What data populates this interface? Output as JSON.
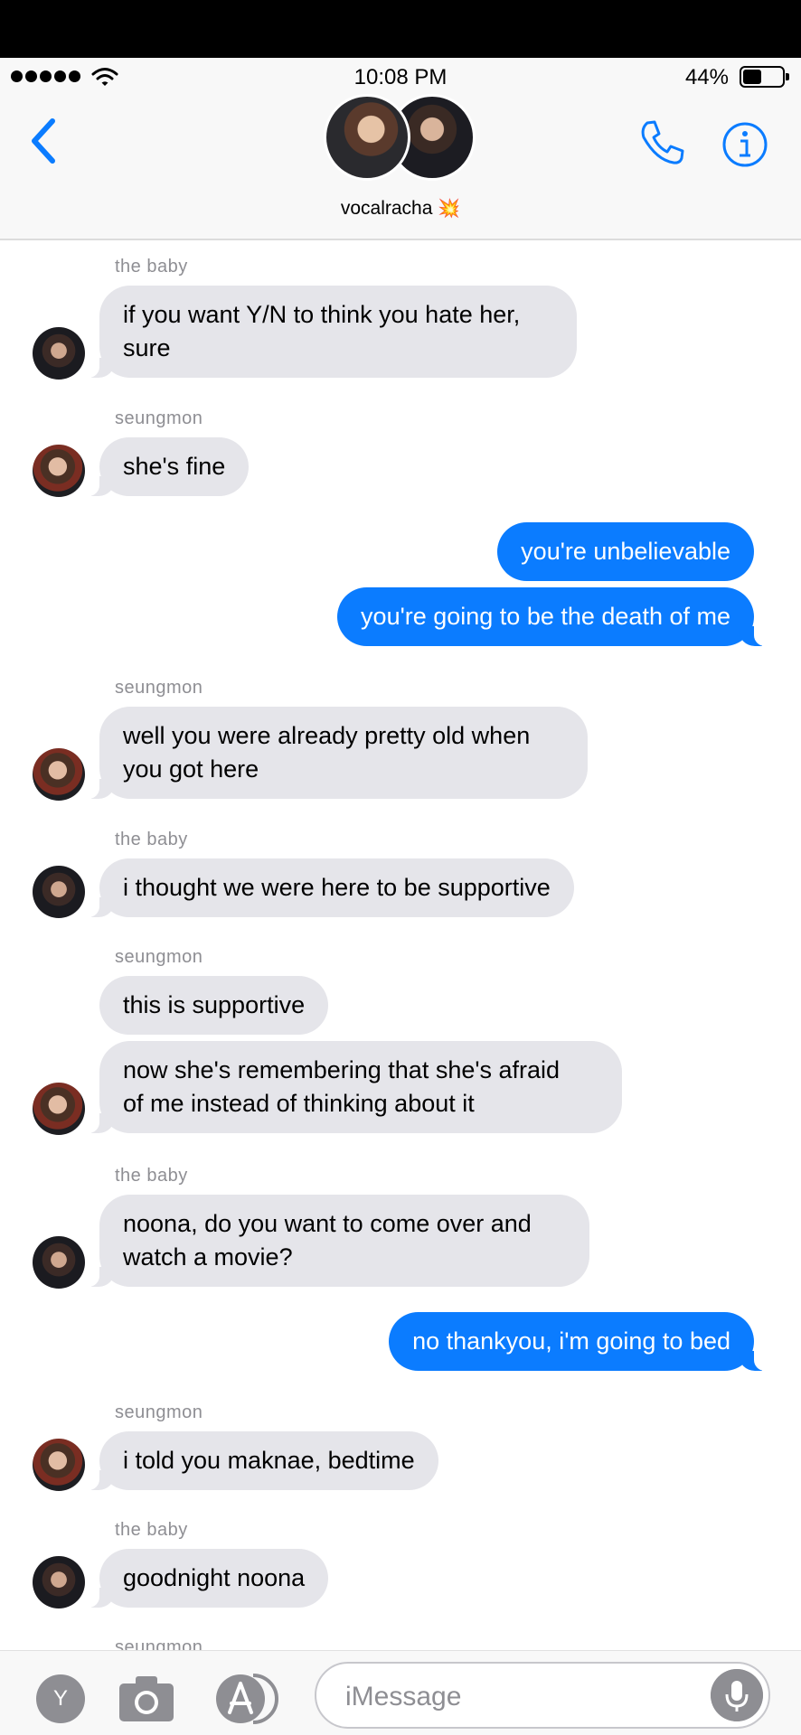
{
  "status_bar": {
    "time": "10:08 PM",
    "battery_percent": "44%",
    "battery_level": 0.44,
    "signal_bars": 5
  },
  "header": {
    "chat_name": "vocalracha",
    "chat_emoji": "💥"
  },
  "colors": {
    "outgoing_bubble": "#0b7cff",
    "incoming_bubble": "#e5e5ea",
    "accent": "#0b7cff",
    "sender_label": "#8e8e93"
  },
  "icons": {
    "back": "chevron-left-icon",
    "phone": "phone-icon",
    "info": "info-icon",
    "camera": "camera-icon",
    "apps": "app-store-icon",
    "mic": "microphone-icon"
  },
  "messages": [
    {
      "sender": "the baby",
      "text": "if you want Y/N to think you hate her,\nsure"
    },
    {
      "sender": "seungmon",
      "text": "she's fine"
    },
    {
      "sender": "",
      "text": "you're unbelievable"
    },
    {
      "sender": "",
      "text": "you're going to be the death of me"
    },
    {
      "sender": "seungmon",
      "text": "well you were already pretty old when\nyou got here"
    },
    {
      "sender": "the baby",
      "text": "i thought we were here to be supportive"
    },
    {
      "sender": "seungmon",
      "text": "this is supportive"
    },
    {
      "sender": "",
      "text": "now she's remembering that she's afraid\nof me instead of thinking about it"
    },
    {
      "sender": "the baby",
      "text": "noona, do you want to come over and\nwatch a movie?"
    },
    {
      "sender": "",
      "text": "no thankyou, i'm going to bed"
    },
    {
      "sender": "seungmon",
      "text": "i told you maknae, bedtime"
    },
    {
      "sender": "the baby",
      "text": "goodnight noona"
    },
    {
      "sender": "seungmon",
      "text": ""
    }
  ],
  "input_bar": {
    "left_button_label": "Y",
    "placeholder": "iMessage"
  }
}
